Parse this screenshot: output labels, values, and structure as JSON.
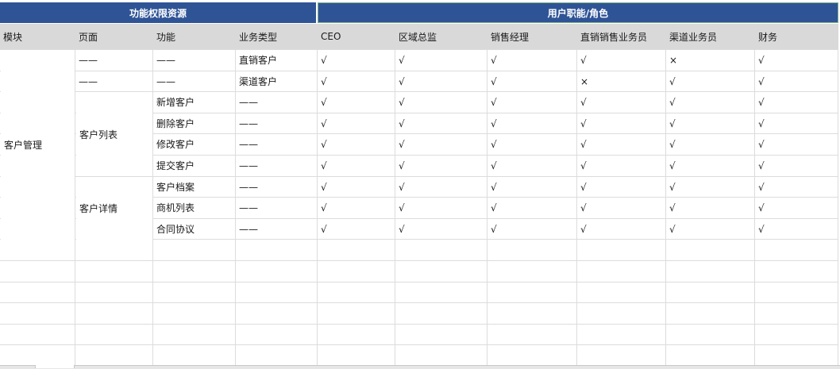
{
  "header": {
    "left_title": "功能权限资源",
    "right_title": "用户职能/角色"
  },
  "columns": [
    "模块",
    "页面",
    "功能",
    "业务类型",
    "CEO",
    "区域总监",
    "销售经理",
    "直销销售业务员",
    "渠道业务员",
    "财务"
  ],
  "module": "客户管理",
  "pages": {
    "list": "客户列表",
    "detail": "客户详情"
  },
  "rows": [
    {
      "page": "——",
      "func": "——",
      "type": "直销客户",
      "marks": [
        "√",
        "√",
        "√",
        "√",
        "×",
        "√"
      ]
    },
    {
      "page": "——",
      "func": "——",
      "type": "渠道客户",
      "marks": [
        "√",
        "√",
        "√",
        "×",
        "√",
        "√"
      ]
    },
    {
      "page": "",
      "func": "新增客户",
      "type": "——",
      "marks": [
        "√",
        "√",
        "√",
        "√",
        "√",
        "√"
      ]
    },
    {
      "page": "",
      "func": "删除客户",
      "type": "——",
      "marks": [
        "√",
        "√",
        "√",
        "√",
        "√",
        "√"
      ]
    },
    {
      "page": "",
      "func": "修改客户",
      "type": "——",
      "marks": [
        "√",
        "√",
        "√",
        "√",
        "√",
        "√"
      ]
    },
    {
      "page": "",
      "func": "提交客户",
      "type": "——",
      "marks": [
        "√",
        "√",
        "√",
        "√",
        "√",
        "√"
      ]
    },
    {
      "page": "",
      "func": "客户档案",
      "type": "——",
      "marks": [
        "√",
        "√",
        "√",
        "√",
        "√",
        "√"
      ]
    },
    {
      "page": "",
      "func": "商机列表",
      "type": "——",
      "marks": [
        "√",
        "√",
        "√",
        "√",
        "√",
        "√"
      ]
    },
    {
      "page": "",
      "func": "合同协议",
      "type": "——",
      "marks": [
        "√",
        "√",
        "√",
        "√",
        "√",
        "√"
      ]
    }
  ]
}
